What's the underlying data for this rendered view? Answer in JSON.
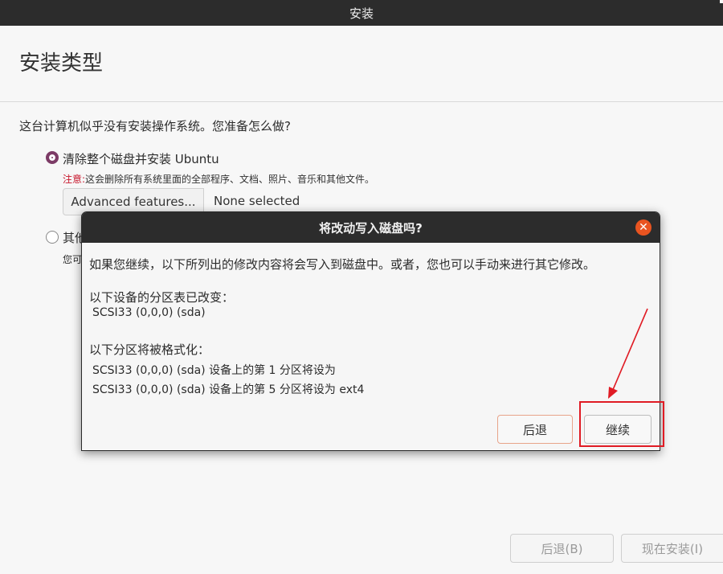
{
  "window": {
    "title": "安装"
  },
  "page": {
    "title": "安装类型",
    "question": "这台计算机似乎没有安装操作系统。您准备怎么做?",
    "option_erase": {
      "label": "清除整个磁盘并安装 Ubuntu",
      "warning_prefix": "注意:",
      "warning_text": "这会删除所有系统里面的全部程序、文档、照片、音乐和其他文件。",
      "advanced_button": "Advanced features...",
      "advanced_value": "None selected"
    },
    "option_other": {
      "label": "其他",
      "desc": "您可"
    },
    "footer": {
      "back_button": "后退(B)",
      "install_button": "现在安装(I)"
    }
  },
  "dialog": {
    "title": "将改动写入磁盘吗?",
    "intro": "如果您继续，以下所列出的修改内容将会写入到磁盘中。或者，您也可以手动来进行其它修改。",
    "partition_table_heading": "以下设备的分区表已改变：",
    "partition_table_device": "SCSI33 (0,0,0) (sda)",
    "format_heading": "以下分区将被格式化：",
    "format_items": [
      "SCSI33 (0,0,0) (sda) 设备上的第 1 分区将设为",
      "SCSI33 (0,0,0) (sda) 设备上的第 5 分区将设为 ext4"
    ],
    "back_button": "后退",
    "continue_button": "继续",
    "close_icon": "close-icon"
  },
  "colors": {
    "accent": "#e95420",
    "radio_selected": "#7c3b66",
    "annotation": "#e01b24"
  }
}
